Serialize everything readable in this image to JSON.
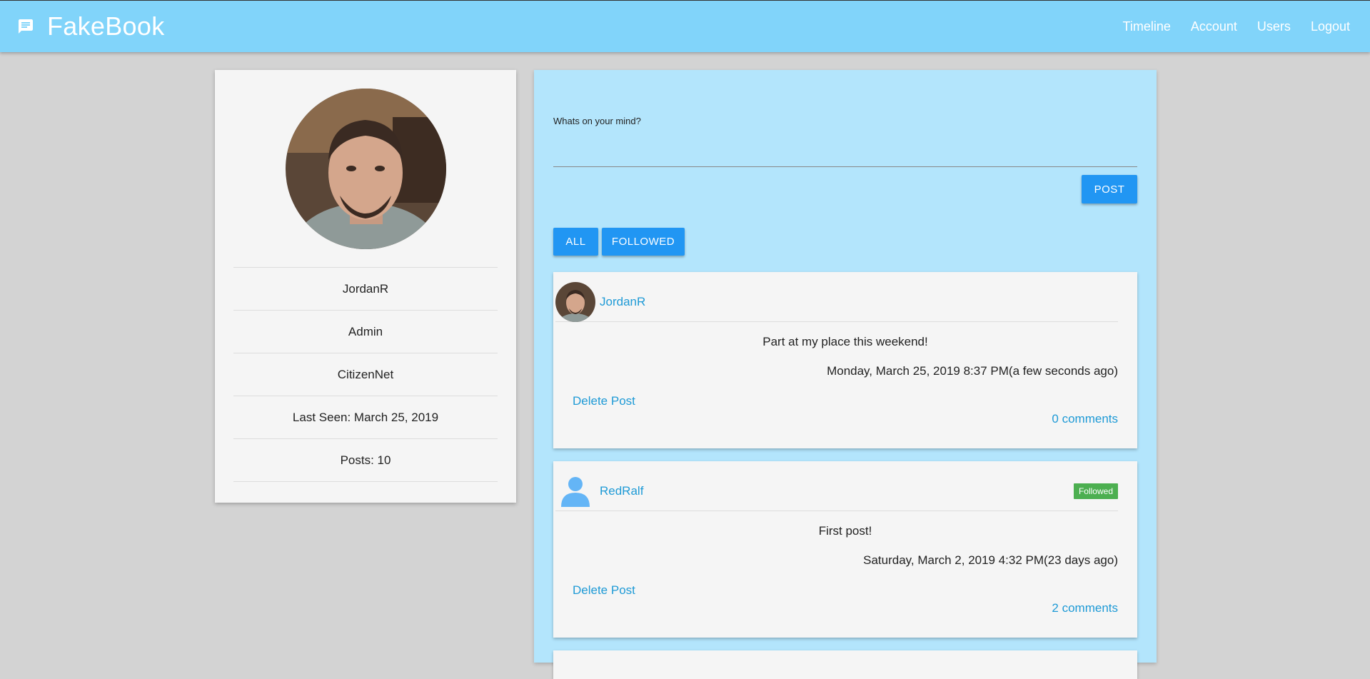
{
  "header": {
    "brand_icon": "chat-message-icon",
    "title": "FakeBook",
    "nav": [
      "Timeline",
      "Account",
      "Users",
      "Logout"
    ]
  },
  "profile": {
    "username": "JordanR",
    "role": "Admin",
    "organization": "CitizenNet",
    "last_seen": "Last Seen: March 25, 2019",
    "posts": "Posts: 10"
  },
  "composer": {
    "label": "Whats on your mind?",
    "value": "",
    "post_label": "POST"
  },
  "filters": {
    "all_label": "ALL",
    "followed_label": "FOLLOWED"
  },
  "posts": [
    {
      "username": "JordanR",
      "text": "Part at my place this weekend!",
      "date": "Monday, March 25, 2019 8:37 PM(a few seconds ago)",
      "delete_label": "Delete Post",
      "comments": "0 comments"
    },
    {
      "username": "RedRalf",
      "badge": "Followed",
      "text": "First post!",
      "date": "Saturday, March 2, 2019 4:32 PM(23 days ago)",
      "delete_label": "Delete Post",
      "comments": "2 comments"
    }
  ],
  "colors": {
    "header": "#81d4fa",
    "panel": "#b3e5fc",
    "button": "#2196f3",
    "link": "#1e9ad6",
    "badge": "#4caf50"
  }
}
